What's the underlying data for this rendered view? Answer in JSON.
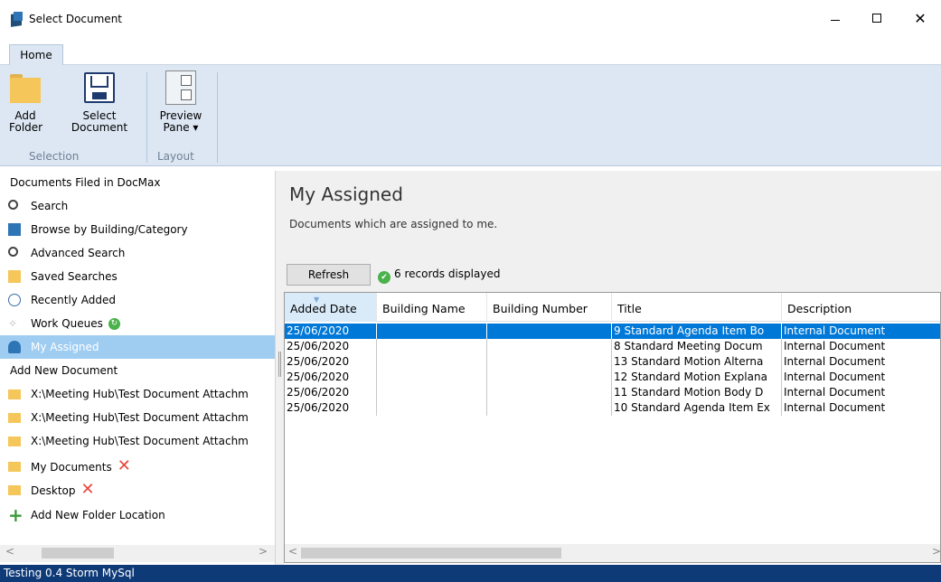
{
  "window": {
    "title": "Select Document",
    "minimize_glyph": "—",
    "close_glyph": "✕"
  },
  "ribbon": {
    "tab_home": "Home",
    "add_folder_line1": "Add",
    "add_folder_line2": "Folder",
    "select_document_line1": "Select",
    "select_document_line2": "Document",
    "preview_pane_line1": "Preview",
    "preview_pane_line2": "Pane ▾",
    "group_selection": "Selection",
    "group_layout": "Layout"
  },
  "nav": {
    "filed_header": "Documents Filed in DocMax",
    "search": "Search",
    "browse": "Browse by Building/Category",
    "advanced_search": "Advanced Search",
    "saved_searches": "Saved Searches",
    "recently_added": "Recently Added",
    "work_queues": "Work Queues",
    "my_assigned": "My Assigned",
    "add_new_header": "Add New Document",
    "folder1": "X:\\Meeting Hub\\Test Document Attachm",
    "folder2": "X:\\Meeting Hub\\Test Document Attachm",
    "folder3": "X:\\Meeting Hub\\Test Document Attachm",
    "my_documents": "My Documents",
    "desktop": "Desktop",
    "add_folder_location": "Add New Folder Location",
    "remove_glyph": "✕",
    "sync_glyph": "↻",
    "plus_glyph": "+",
    "queue_glyph": "✧"
  },
  "main": {
    "title": "My Assigned",
    "subtitle": "Documents which are assigned to me.",
    "refresh_label": "Refresh",
    "records_text": "6 records displayed",
    "check_glyph": "✔"
  },
  "grid": {
    "columns": [
      "Added Date",
      "Building Name",
      "Building Number",
      "Title",
      "Description"
    ],
    "rows": [
      {
        "added_date": "25/06/2020",
        "building_name": "",
        "building_number": "",
        "title": "9 Standard Agenda Item Bo",
        "description": "Internal Document"
      },
      {
        "added_date": "25/06/2020",
        "building_name": "",
        "building_number": "",
        "title": "8 Standard Meeting Docum",
        "description": "Internal Document"
      },
      {
        "added_date": "25/06/2020",
        "building_name": "",
        "building_number": "",
        "title": "13 Standard Motion Alterna",
        "description": "Internal Document"
      },
      {
        "added_date": "25/06/2020",
        "building_name": "",
        "building_number": "",
        "title": "12 Standard Motion Explana",
        "description": "Internal Document"
      },
      {
        "added_date": "25/06/2020",
        "building_name": "",
        "building_number": "",
        "title": "11 Standard Motion Body D",
        "description": "Internal Document"
      },
      {
        "added_date": "25/06/2020",
        "building_name": "",
        "building_number": "",
        "title": "10 Standard Agenda Item Ex",
        "description": "Internal Document"
      }
    ]
  },
  "scroll": {
    "left_arrow": "<",
    "right_arrow": ">"
  },
  "status": {
    "text": "Testing 0.4 Storm MySql"
  },
  "colors": {
    "selection": "#0078d7",
    "nav_selected": "#9fcdf2",
    "statusbar": "#0f3a78",
    "ribbon": "#dce7f3"
  }
}
